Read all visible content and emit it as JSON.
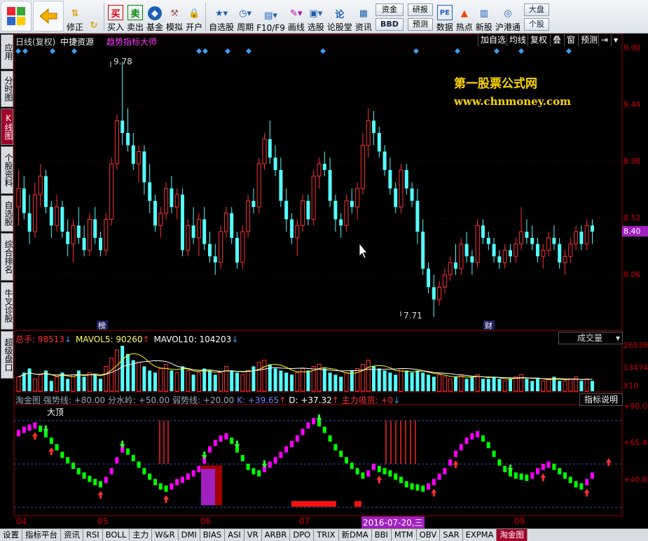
{
  "toolbar": {
    "buttons": [
      {
        "id": "fixed",
        "label": "修正"
      },
      {
        "id": "buy",
        "label": "买入"
      },
      {
        "id": "sell",
        "label": "卖出"
      },
      {
        "id": "fund",
        "label": "基金"
      },
      {
        "id": "sim",
        "label": "模拟"
      },
      {
        "id": "open",
        "label": "开户"
      },
      {
        "id": "selfsel",
        "label": "自选股"
      },
      {
        "id": "period",
        "label": "周期"
      },
      {
        "id": "f10",
        "label": "F10/F9"
      },
      {
        "id": "draw",
        "label": "画线"
      },
      {
        "id": "pick",
        "label": "选股"
      },
      {
        "id": "forum",
        "label": "论股堂"
      },
      {
        "id": "news",
        "label": "资讯"
      },
      {
        "id": "data",
        "label": "数据"
      },
      {
        "id": "hot",
        "label": "热点"
      },
      {
        "id": "newstock",
        "label": "新股"
      },
      {
        "id": "hkconnect",
        "label": "沪港通"
      }
    ],
    "stack1": {
      "top": "资金",
      "bottom": "BBD"
    },
    "stack2": {
      "top": "研报",
      "bottom": "预测"
    },
    "stack3": {
      "top": "大盘",
      "bottom": "个股"
    },
    "pe_label": "PE"
  },
  "left_tabs": [
    "应用",
    "分时图",
    "K线图",
    "个股资料",
    "自选股",
    "综合排名",
    "牛叉诊股",
    "超级盘口"
  ],
  "header": {
    "period": "日线(复权)",
    "stock": "中捷资源",
    "indicator": "趋势指标大师",
    "buttons": [
      "加自选",
      "均线",
      "复权",
      "叠",
      "窗",
      "预测"
    ]
  },
  "watermark": {
    "line1": "第一股票公式网",
    "line2": "www.chnmoney.com"
  },
  "price_axis": {
    "labels": [
      "9.90",
      "9.44",
      "8.98",
      "8.52",
      "8.06"
    ],
    "current": "8.40"
  },
  "high_label": "9.78",
  "low_label": "7.71",
  "markers": {
    "bang": "榜",
    "cai": "财"
  },
  "volume": {
    "legend": [
      {
        "name": "总手: ",
        "value": "98513",
        "arrow": "↓"
      },
      {
        "name": "MAVOL5: ",
        "value": "90260",
        "arrow": "↑"
      },
      {
        "name": "MAVOL10: ",
        "value": "104203",
        "arrow": "↓"
      }
    ],
    "dropdown": "成交量",
    "axis": [
      "26539",
      "13474",
      "X10"
    ]
  },
  "indicator_panel": {
    "legend": [
      {
        "name": "淘金图 ",
        "value": ""
      },
      {
        "name": "强势线: ",
        "value": "+80.00"
      },
      {
        "name": "分水岭: ",
        "value": "+50.00"
      },
      {
        "name": "弱势线: ",
        "value": "+20.00"
      },
      {
        "name": "K: ",
        "value": "+39.65",
        "arrow": "↑"
      },
      {
        "name": "D: ",
        "value": "+37.32",
        "arrow": "↑"
      },
      {
        "name": "主力吸货: ",
        "value": "+0",
        "arrow": "↓"
      }
    ],
    "button": "指标说明",
    "top_label": "大顶",
    "axis": [
      "+90.00",
      "+65.40",
      "+40.80"
    ]
  },
  "x_axis": {
    "labels": [
      "04",
      "05",
      "06",
      "07",
      "08",
      "09"
    ],
    "cursor_date": "2016-07-20,三"
  },
  "bottom_tabs": [
    "设置",
    "指标平台",
    "资讯",
    "RSI",
    "BOLL",
    "主力",
    "W&R",
    "DMI",
    "BIAS",
    "ASI",
    "VR",
    "ARBR",
    "DPO",
    "TRIX",
    "新DMA",
    "BBI",
    "MTM",
    "OBV",
    "SAR",
    "EXPMA",
    "淘金图"
  ],
  "colors": {
    "up": "#ff3232",
    "down": "#54fcfc",
    "axis": "#c00000",
    "accent": "#a2002a",
    "ma_white": "#ffffff",
    "ma_yellow": "#ffff00",
    "magenta": "#ff00ff",
    "green": "#00ff00"
  },
  "chart_data": {
    "type": "candlestick",
    "ylim": [
      7.6,
      10.0
    ],
    "ohlc": [
      [
        8.6,
        8.9,
        8.45,
        8.75
      ],
      [
        8.75,
        8.85,
        8.5,
        8.55
      ],
      [
        8.55,
        8.7,
        8.3,
        8.4
      ],
      [
        8.4,
        8.8,
        8.35,
        8.7
      ],
      [
        8.7,
        8.95,
        8.6,
        8.85
      ],
      [
        8.85,
        8.9,
        8.55,
        8.6
      ],
      [
        8.6,
        8.65,
        8.35,
        8.45
      ],
      [
        8.45,
        8.7,
        8.4,
        8.6
      ],
      [
        8.6,
        8.65,
        8.35,
        8.4
      ],
      [
        8.4,
        8.5,
        8.2,
        8.3
      ],
      [
        8.3,
        8.5,
        8.15,
        8.45
      ],
      [
        8.45,
        8.6,
        8.3,
        8.35
      ],
      [
        8.35,
        8.45,
        8.2,
        8.25
      ],
      [
        8.25,
        8.55,
        8.2,
        8.5
      ],
      [
        8.5,
        8.6,
        8.3,
        8.35
      ],
      [
        8.35,
        8.4,
        8.2,
        8.25
      ],
      [
        8.25,
        8.55,
        8.2,
        8.5
      ],
      [
        8.5,
        9.0,
        8.45,
        8.95
      ],
      [
        8.95,
        9.35,
        8.9,
        9.3
      ],
      [
        9.3,
        9.78,
        9.1,
        9.2
      ],
      [
        9.2,
        9.4,
        9.05,
        9.1
      ],
      [
        9.1,
        9.2,
        8.9,
        8.95
      ],
      [
        8.95,
        9.1,
        8.8,
        9.05
      ],
      [
        9.05,
        9.1,
        8.7,
        8.8
      ],
      [
        8.8,
        8.95,
        8.55,
        8.65
      ],
      [
        8.65,
        8.7,
        8.4,
        8.45
      ],
      [
        8.45,
        8.6,
        8.35,
        8.55
      ],
      [
        8.55,
        8.8,
        8.5,
        8.75
      ],
      [
        8.75,
        8.85,
        8.55,
        8.6
      ],
      [
        8.6,
        8.75,
        8.5,
        8.7
      ],
      [
        8.7,
        8.75,
        8.2,
        8.25
      ],
      [
        8.25,
        8.5,
        8.2,
        8.45
      ],
      [
        8.45,
        8.6,
        8.3,
        8.35
      ],
      [
        8.35,
        8.55,
        8.2,
        8.5
      ],
      [
        8.5,
        8.6,
        8.25,
        8.3
      ],
      [
        8.3,
        8.4,
        8.15,
        8.2
      ],
      [
        8.2,
        8.3,
        8.05,
        8.15
      ],
      [
        8.15,
        8.45,
        8.1,
        8.4
      ],
      [
        8.4,
        8.6,
        8.35,
        8.55
      ],
      [
        8.55,
        8.6,
        8.3,
        8.35
      ],
      [
        8.35,
        8.4,
        8.1,
        8.15
      ],
      [
        8.15,
        8.45,
        8.1,
        8.4
      ],
      [
        8.4,
        8.7,
        8.35,
        8.65
      ],
      [
        8.65,
        8.75,
        8.55,
        8.6
      ],
      [
        8.6,
        9.0,
        8.55,
        8.95
      ],
      [
        8.95,
        9.2,
        8.9,
        9.15
      ],
      [
        9.15,
        9.3,
        8.95,
        9.0
      ],
      [
        9.0,
        9.1,
        8.85,
        8.9
      ],
      [
        8.9,
        9.0,
        8.6,
        8.65
      ],
      [
        8.65,
        8.75,
        8.4,
        8.5
      ],
      [
        8.5,
        8.55,
        8.3,
        8.35
      ],
      [
        8.35,
        8.5,
        8.2,
        8.45
      ],
      [
        8.45,
        8.7,
        8.4,
        8.65
      ],
      [
        8.65,
        8.7,
        8.45,
        8.5
      ],
      [
        8.5,
        8.9,
        8.45,
        8.85
      ],
      [
        8.85,
        9.0,
        8.75,
        8.95
      ],
      [
        8.95,
        9.05,
        8.85,
        8.9
      ],
      [
        8.9,
        9.0,
        8.6,
        8.65
      ],
      [
        8.65,
        8.7,
        8.4,
        8.5
      ],
      [
        8.5,
        8.55,
        8.35,
        8.45
      ],
      [
        8.45,
        8.7,
        8.4,
        8.65
      ],
      [
        8.65,
        8.75,
        8.55,
        8.6
      ],
      [
        8.6,
        8.8,
        8.5,
        8.75
      ],
      [
        8.75,
        9.2,
        8.7,
        9.1
      ],
      [
        9.1,
        9.4,
        9.0,
        9.3
      ],
      [
        9.3,
        9.38,
        9.1,
        9.2
      ],
      [
        9.2,
        9.25,
        9.0,
        9.05
      ],
      [
        9.05,
        9.1,
        8.85,
        8.9
      ],
      [
        8.9,
        9.0,
        8.7,
        8.75
      ],
      [
        8.75,
        8.8,
        8.55,
        8.6
      ],
      [
        8.6,
        8.95,
        8.55,
        8.9
      ],
      [
        8.9,
        8.95,
        8.7,
        8.75
      ],
      [
        8.75,
        8.8,
        8.6,
        8.65
      ],
      [
        8.65,
        8.75,
        8.3,
        8.4
      ],
      [
        8.4,
        8.5,
        8.05,
        8.1
      ],
      [
        8.1,
        8.15,
        7.9,
        7.95
      ],
      [
        7.95,
        8.05,
        7.71,
        7.85
      ],
      [
        7.85,
        8.0,
        7.8,
        7.95
      ],
      [
        7.95,
        8.1,
        7.9,
        8.05
      ],
      [
        8.05,
        8.2,
        8.0,
        8.15
      ],
      [
        8.15,
        8.3,
        8.05,
        8.1
      ],
      [
        8.1,
        8.35,
        8.05,
        8.3
      ],
      [
        8.3,
        8.4,
        8.15,
        8.2
      ],
      [
        8.2,
        8.25,
        8.05,
        8.15
      ],
      [
        8.15,
        8.5,
        8.1,
        8.45
      ],
      [
        8.45,
        8.5,
        8.3,
        8.35
      ],
      [
        8.35,
        8.4,
        8.25,
        8.3
      ],
      [
        8.3,
        8.35,
        8.15,
        8.2
      ],
      [
        8.2,
        8.25,
        8.1,
        8.15
      ],
      [
        8.15,
        8.3,
        8.1,
        8.25
      ],
      [
        8.25,
        8.3,
        8.15,
        8.2
      ],
      [
        8.2,
        8.35,
        8.15,
        8.3
      ],
      [
        8.3,
        8.6,
        8.25,
        8.4
      ],
      [
        8.4,
        8.5,
        8.3,
        8.35
      ],
      [
        8.35,
        8.45,
        8.25,
        8.3
      ],
      [
        8.3,
        8.35,
        8.15,
        8.2
      ],
      [
        8.2,
        8.3,
        8.1,
        8.25
      ],
      [
        8.25,
        8.4,
        8.2,
        8.35
      ],
      [
        8.35,
        8.45,
        8.25,
        8.3
      ],
      [
        8.3,
        8.35,
        8.1,
        8.15
      ],
      [
        8.15,
        8.25,
        8.05,
        8.2
      ],
      [
        8.2,
        8.35,
        8.15,
        8.3
      ],
      [
        8.3,
        8.45,
        8.25,
        8.4
      ],
      [
        8.4,
        8.45,
        8.25,
        8.3
      ],
      [
        8.3,
        8.5,
        8.25,
        8.45
      ],
      [
        8.45,
        8.5,
        8.3,
        8.4
      ]
    ],
    "volume": [
      7,
      9,
      11,
      6,
      8,
      10,
      5,
      7,
      9,
      6,
      8,
      10,
      7,
      9,
      8,
      6,
      12,
      16,
      20,
      22,
      18,
      15,
      14,
      12,
      10,
      9,
      11,
      13,
      10,
      9,
      12,
      10,
      8,
      9,
      11,
      10,
      8,
      9,
      12,
      10,
      9,
      8,
      10,
      12,
      14,
      15,
      13,
      11,
      10,
      9,
      8,
      9,
      11,
      10,
      12,
      13,
      11,
      9,
      8,
      7,
      9,
      10,
      11,
      13,
      15,
      12,
      11,
      10,
      9,
      8,
      11,
      10,
      9,
      10,
      9,
      8,
      7,
      8,
      7,
      6,
      7,
      8,
      6,
      7,
      8,
      6,
      6,
      7,
      6,
      5,
      6,
      7,
      8,
      6,
      5,
      6,
      5,
      6,
      7,
      5,
      5,
      6,
      7,
      5,
      6,
      5
    ],
    "kd": [
      75,
      78,
      80,
      82,
      79,
      74,
      68,
      62,
      55,
      50,
      45,
      40,
      36,
      33,
      30,
      28,
      32,
      40,
      50,
      60,
      58,
      52,
      46,
      40,
      35,
      30,
      26,
      24,
      26,
      30,
      32,
      35,
      38,
      42,
      50,
      60,
      66,
      70,
      72,
      68,
      60,
      52,
      44,
      40,
      38,
      42,
      46,
      50,
      55,
      60,
      65,
      70,
      76,
      82,
      86,
      84,
      78,
      70,
      62,
      56,
      50,
      45,
      40,
      36,
      38,
      44,
      42,
      40,
      38,
      35,
      32,
      28,
      26,
      25,
      24,
      26,
      30,
      35,
      40,
      48,
      56,
      62,
      68,
      72,
      74,
      70,
      64,
      56,
      48,
      42,
      38,
      36,
      35,
      34,
      36,
      40,
      44,
      46,
      44,
      40,
      36,
      32,
      28,
      26,
      30,
      36,
      44,
      52,
      58,
      62
    ]
  }
}
